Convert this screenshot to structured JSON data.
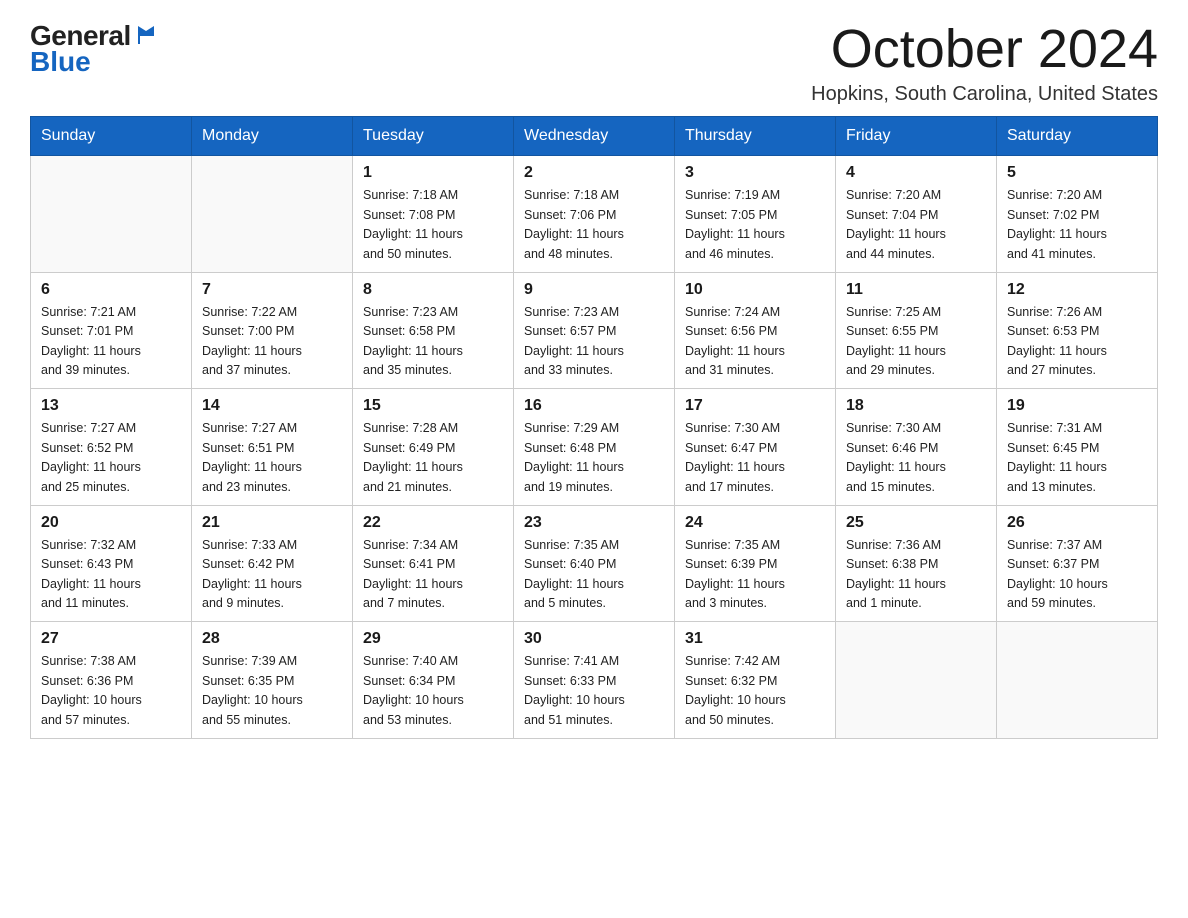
{
  "header": {
    "logo_general": "General",
    "logo_blue": "Blue",
    "month_title": "October 2024",
    "location": "Hopkins, South Carolina, United States"
  },
  "calendar": {
    "days_of_week": [
      "Sunday",
      "Monday",
      "Tuesday",
      "Wednesday",
      "Thursday",
      "Friday",
      "Saturday"
    ],
    "weeks": [
      [
        {
          "day": "",
          "info": ""
        },
        {
          "day": "",
          "info": ""
        },
        {
          "day": "1",
          "info": "Sunrise: 7:18 AM\nSunset: 7:08 PM\nDaylight: 11 hours\nand 50 minutes."
        },
        {
          "day": "2",
          "info": "Sunrise: 7:18 AM\nSunset: 7:06 PM\nDaylight: 11 hours\nand 48 minutes."
        },
        {
          "day": "3",
          "info": "Sunrise: 7:19 AM\nSunset: 7:05 PM\nDaylight: 11 hours\nand 46 minutes."
        },
        {
          "day": "4",
          "info": "Sunrise: 7:20 AM\nSunset: 7:04 PM\nDaylight: 11 hours\nand 44 minutes."
        },
        {
          "day": "5",
          "info": "Sunrise: 7:20 AM\nSunset: 7:02 PM\nDaylight: 11 hours\nand 41 minutes."
        }
      ],
      [
        {
          "day": "6",
          "info": "Sunrise: 7:21 AM\nSunset: 7:01 PM\nDaylight: 11 hours\nand 39 minutes."
        },
        {
          "day": "7",
          "info": "Sunrise: 7:22 AM\nSunset: 7:00 PM\nDaylight: 11 hours\nand 37 minutes."
        },
        {
          "day": "8",
          "info": "Sunrise: 7:23 AM\nSunset: 6:58 PM\nDaylight: 11 hours\nand 35 minutes."
        },
        {
          "day": "9",
          "info": "Sunrise: 7:23 AM\nSunset: 6:57 PM\nDaylight: 11 hours\nand 33 minutes."
        },
        {
          "day": "10",
          "info": "Sunrise: 7:24 AM\nSunset: 6:56 PM\nDaylight: 11 hours\nand 31 minutes."
        },
        {
          "day": "11",
          "info": "Sunrise: 7:25 AM\nSunset: 6:55 PM\nDaylight: 11 hours\nand 29 minutes."
        },
        {
          "day": "12",
          "info": "Sunrise: 7:26 AM\nSunset: 6:53 PM\nDaylight: 11 hours\nand 27 minutes."
        }
      ],
      [
        {
          "day": "13",
          "info": "Sunrise: 7:27 AM\nSunset: 6:52 PM\nDaylight: 11 hours\nand 25 minutes."
        },
        {
          "day": "14",
          "info": "Sunrise: 7:27 AM\nSunset: 6:51 PM\nDaylight: 11 hours\nand 23 minutes."
        },
        {
          "day": "15",
          "info": "Sunrise: 7:28 AM\nSunset: 6:49 PM\nDaylight: 11 hours\nand 21 minutes."
        },
        {
          "day": "16",
          "info": "Sunrise: 7:29 AM\nSunset: 6:48 PM\nDaylight: 11 hours\nand 19 minutes."
        },
        {
          "day": "17",
          "info": "Sunrise: 7:30 AM\nSunset: 6:47 PM\nDaylight: 11 hours\nand 17 minutes."
        },
        {
          "day": "18",
          "info": "Sunrise: 7:30 AM\nSunset: 6:46 PM\nDaylight: 11 hours\nand 15 minutes."
        },
        {
          "day": "19",
          "info": "Sunrise: 7:31 AM\nSunset: 6:45 PM\nDaylight: 11 hours\nand 13 minutes."
        }
      ],
      [
        {
          "day": "20",
          "info": "Sunrise: 7:32 AM\nSunset: 6:43 PM\nDaylight: 11 hours\nand 11 minutes."
        },
        {
          "day": "21",
          "info": "Sunrise: 7:33 AM\nSunset: 6:42 PM\nDaylight: 11 hours\nand 9 minutes."
        },
        {
          "day": "22",
          "info": "Sunrise: 7:34 AM\nSunset: 6:41 PM\nDaylight: 11 hours\nand 7 minutes."
        },
        {
          "day": "23",
          "info": "Sunrise: 7:35 AM\nSunset: 6:40 PM\nDaylight: 11 hours\nand 5 minutes."
        },
        {
          "day": "24",
          "info": "Sunrise: 7:35 AM\nSunset: 6:39 PM\nDaylight: 11 hours\nand 3 minutes."
        },
        {
          "day": "25",
          "info": "Sunrise: 7:36 AM\nSunset: 6:38 PM\nDaylight: 11 hours\nand 1 minute."
        },
        {
          "day": "26",
          "info": "Sunrise: 7:37 AM\nSunset: 6:37 PM\nDaylight: 10 hours\nand 59 minutes."
        }
      ],
      [
        {
          "day": "27",
          "info": "Sunrise: 7:38 AM\nSunset: 6:36 PM\nDaylight: 10 hours\nand 57 minutes."
        },
        {
          "day": "28",
          "info": "Sunrise: 7:39 AM\nSunset: 6:35 PM\nDaylight: 10 hours\nand 55 minutes."
        },
        {
          "day": "29",
          "info": "Sunrise: 7:40 AM\nSunset: 6:34 PM\nDaylight: 10 hours\nand 53 minutes."
        },
        {
          "day": "30",
          "info": "Sunrise: 7:41 AM\nSunset: 6:33 PM\nDaylight: 10 hours\nand 51 minutes."
        },
        {
          "day": "31",
          "info": "Sunrise: 7:42 AM\nSunset: 6:32 PM\nDaylight: 10 hours\nand 50 minutes."
        },
        {
          "day": "",
          "info": ""
        },
        {
          "day": "",
          "info": ""
        }
      ]
    ]
  }
}
